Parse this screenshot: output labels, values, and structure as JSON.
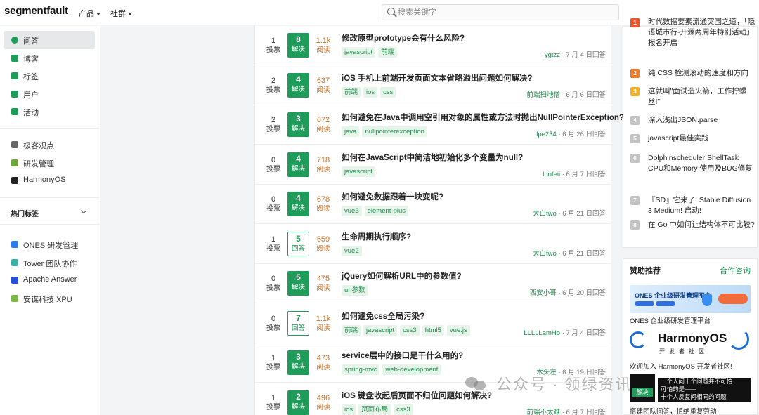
{
  "header": {
    "logo": "segmentfault",
    "nav": [
      {
        "label": "产品"
      },
      {
        "label": "社群"
      }
    ],
    "search_placeholder": "搜索关键字"
  },
  "sidebar": {
    "items": [
      {
        "label": "问答",
        "color": "#1d9c5a",
        "icon": "qa-icon",
        "active": true
      },
      {
        "label": "博客",
        "color": "#1d9c5a",
        "icon": "blog-icon"
      },
      {
        "label": "标签",
        "color": "#1d9c5a",
        "icon": "tag-icon"
      },
      {
        "label": "用户",
        "color": "#1d9c5a",
        "icon": "users-icon"
      },
      {
        "label": "活动",
        "color": "#1d9c5a",
        "icon": "calendar-icon"
      }
    ],
    "extra": [
      {
        "label": "极客观点",
        "color": "#666666",
        "icon": "insight-icon"
      },
      {
        "label": "研发管理",
        "color": "#6fa83a",
        "icon": "devops-icon"
      },
      {
        "label": "HarmonyOS",
        "color": "#222222",
        "icon": "harmony-icon"
      }
    ],
    "hot_tags_label": "热门标签",
    "partners": [
      {
        "label": "ONES 研发管理",
        "color": "#2d7bf0",
        "icon": "ones-icon"
      },
      {
        "label": "Tower 团队协作",
        "color": "#38b0a6",
        "icon": "tower-icon"
      },
      {
        "label": "Apache Answer",
        "color": "#2150d6",
        "icon": "answer-icon"
      },
      {
        "label": "安谋科技 XPU",
        "color": "#7ab648",
        "icon": "xpu-icon"
      }
    ]
  },
  "questions": [
    {
      "votes": "1",
      "votes_label": "投票",
      "answers": "8",
      "status": "解决",
      "solved": true,
      "views": "1.1k",
      "views_label": "阅读",
      "title": "修改原型prototype会有什么风险?",
      "tags": [
        "javascript",
        "前端"
      ],
      "author": "ygtzz",
      "time": "· 7 月 4 日回答"
    },
    {
      "votes": "2",
      "votes_label": "投票",
      "answers": "4",
      "status": "解决",
      "solved": true,
      "views": "637",
      "views_label": "阅读",
      "title": "iOS 手机上前端开发页面文本省略溢出问题如何解决?",
      "tags": [
        "前端",
        "ios",
        "css"
      ],
      "author": "前端扫地僧",
      "time": "· 6 月 6 日回答"
    },
    {
      "votes": "2",
      "votes_label": "投票",
      "answers": "3",
      "status": "解决",
      "solved": true,
      "views": "672",
      "views_label": "阅读",
      "title": "如何避免在Java中调用空引用对象的属性或方法时抛出NullPointerException?",
      "tags": [
        "java",
        "nullpointerexception"
      ],
      "author": "lpe234",
      "time": "· 6 月 26 日回答"
    },
    {
      "votes": "0",
      "votes_label": "投票",
      "answers": "4",
      "status": "解决",
      "solved": true,
      "views": "718",
      "views_label": "阅读",
      "title": "如何在JavaScript中简洁地初始化多个变量为null?",
      "tags": [
        "javascript"
      ],
      "author": "luofeii",
      "time": "· 6 月 7 日回答"
    },
    {
      "votes": "0",
      "votes_label": "投票",
      "answers": "4",
      "status": "解决",
      "solved": true,
      "views": "678",
      "views_label": "阅读",
      "title": "如何避免数据跟着一块变呢?",
      "tags": [
        "vue3",
        "element-plus"
      ],
      "author": "大白two",
      "time": "· 6 月 21 日回答"
    },
    {
      "votes": "1",
      "votes_label": "投票",
      "answers": "5",
      "status": "回答",
      "solved": false,
      "views": "659",
      "views_label": "阅读",
      "title": "生命周期执行顺序?",
      "tags": [
        "vue2"
      ],
      "author": "大白two",
      "time": "· 6 月 21 日回答"
    },
    {
      "votes": "0",
      "votes_label": "投票",
      "answers": "5",
      "status": "解决",
      "solved": true,
      "views": "475",
      "views_label": "阅读",
      "title": "jQuery如何解析URL中的参数值?",
      "tags": [
        "url参数"
      ],
      "author": "西安小哥",
      "time": "· 6 月 20 日回答"
    },
    {
      "votes": "0",
      "votes_label": "投票",
      "answers": "7",
      "status": "回答",
      "solved": false,
      "views": "1.1k",
      "views_label": "阅读",
      "title": "如何避免css全局污染?",
      "tags": [
        "前端",
        "javascript",
        "css3",
        "html5",
        "vue.js"
      ],
      "author": "LLLLLamHo",
      "time": "· 7 月 4 日回答"
    },
    {
      "votes": "1",
      "votes_label": "投票",
      "answers": "3",
      "status": "解决",
      "solved": true,
      "views": "473",
      "views_label": "阅读",
      "title": "service层中的接口是干什么用的?",
      "tags": [
        "spring-mvc",
        "web-development"
      ],
      "author": "木头左",
      "time": "· 6 月 19 日回答"
    },
    {
      "votes": "1",
      "votes_label": "投票",
      "answers": "2",
      "status": "解决",
      "solved": true,
      "views": "496",
      "views_label": "阅读",
      "title": "iOS 键盘收起后页面不归位问题如何解决?",
      "tags": [
        "ios",
        "页面布局",
        "css3"
      ],
      "author": "前端不太难",
      "time": "· 6 月 7 日回答"
    }
  ],
  "hot_list": [
    {
      "num": "2",
      "color": "#f07a2a",
      "text": "纯 CSS 检测滚动的速度和方向"
    },
    {
      "num": "3",
      "color": "#f3b020",
      "text": "这就叫\"面试造火箭，工作拧螺丝!\""
    },
    {
      "num": "4",
      "color": "#c3c3c3",
      "text": "深入浅出JSON.parse"
    },
    {
      "num": "5",
      "color": "#c3c3c3",
      "text": "javascript最佳实践"
    },
    {
      "num": "6",
      "color": "#c3c3c3",
      "text": "Dolphinscheduler ShellTask CPU和Memory 使用及BUG修复"
    },
    {
      "num": "7",
      "color": "#c3c3c3",
      "text": "『SD』它来了! Stable Diffusion 3 Medium! 启动!"
    },
    {
      "num": "8",
      "color": "#c3c3c3",
      "text": "在 Go 中如何让结构体不可比较?"
    }
  ],
  "hot_top_partial": "时代数据要素流通突围之道，「隐语城市行-开源两周年特别活动」报名开启",
  "sponsor": {
    "title": "赞助推荐",
    "link": "合作咨询",
    "banner1_text": "ONES 企业级研发管理平台",
    "caption1": "ONES 企业级研发管理平台",
    "harmony_name": "HarmonyOS",
    "harmony_sub": "开发者社区",
    "caption2": "欢迎加入 HarmonyOS 开发者社区!",
    "banner3_btn": "解决",
    "banner3_line1": "一个人问十个问题并不可怕",
    "banner3_line2": "可怕的是——",
    "banner3_line3": "十个人反复问相同的问题",
    "caption3": "搭建团队问答，拒绝重复劳动"
  },
  "watermark": "公众号 · 领绿资讯"
}
